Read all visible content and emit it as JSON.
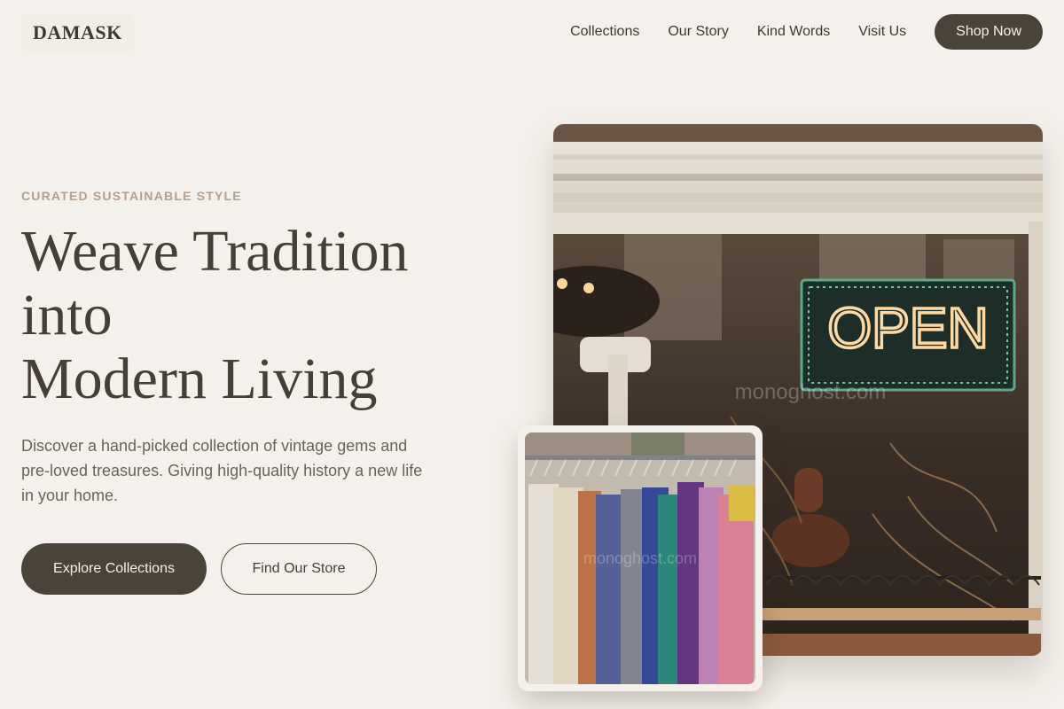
{
  "brand": {
    "logo_text": "DAMASK"
  },
  "nav": {
    "links": [
      "Collections",
      "Our Story",
      "Kind Words",
      "Visit Us"
    ],
    "cta_label": "Shop Now"
  },
  "hero": {
    "eyebrow": "CURATED SUSTAINABLE STYLE",
    "headline_lines": [
      "Weave Tradition",
      "into",
      "Modern Living"
    ],
    "lede": "Discover a hand-picked collection of vintage gems and pre-loved treasures. Giving high-quality history a new life in your home.",
    "primary_button": "Explore Collections",
    "secondary_button": "Find Our Store"
  },
  "images": {
    "main_sign_text": "OPEN",
    "watermark": "monoghost.com"
  },
  "colors": {
    "background": "#f4f1ec",
    "primary": "#4a433a",
    "eyebrow": "#b79d8a",
    "text": "#463f37"
  }
}
